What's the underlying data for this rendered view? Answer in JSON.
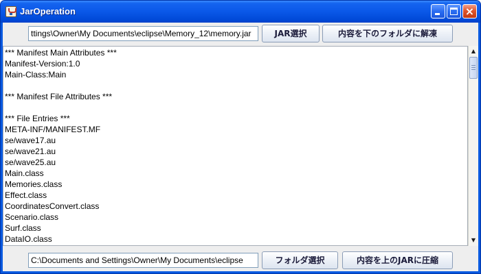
{
  "window": {
    "title": "JarOperation",
    "controls": {
      "minimize": "minimize",
      "maximize": "maximize",
      "close": "×"
    }
  },
  "top": {
    "jar_path": "ttings\\Owner\\My Documents\\eclipse\\Memory_12\\memory.jar",
    "select_jar_label": "JAR選択",
    "extract_label": "内容を下のフォルダに解凍"
  },
  "content": {
    "lines": [
      "*** Manifest Main Attributes ***",
      "Manifest-Version:1.0",
      "Main-Class:Main",
      "",
      "*** Manifest File Attributes ***",
      "",
      "*** File Entries ***",
      "META-INF/MANIFEST.MF",
      "se/wave17.au",
      "se/wave21.au",
      "se/wave25.au",
      "Main.class",
      "Memories.class",
      "Effect.class",
      "CoordinatesConvert.class",
      "Scenario.class",
      "Surf.class",
      "DataIO.class"
    ]
  },
  "scrollbar": {
    "up_arrow": "▲",
    "down_arrow": "▼"
  },
  "bottom": {
    "folder_path": "C:\\Documents and Settings\\Owner\\My Documents\\eclipse",
    "select_folder_label": "フォルダ選択",
    "compress_label": "内容を上のJARに圧縮"
  },
  "colors": {
    "titlebar": "#0a58e8",
    "client_bg": "#eeeeee",
    "close_button": "#e0552c"
  }
}
